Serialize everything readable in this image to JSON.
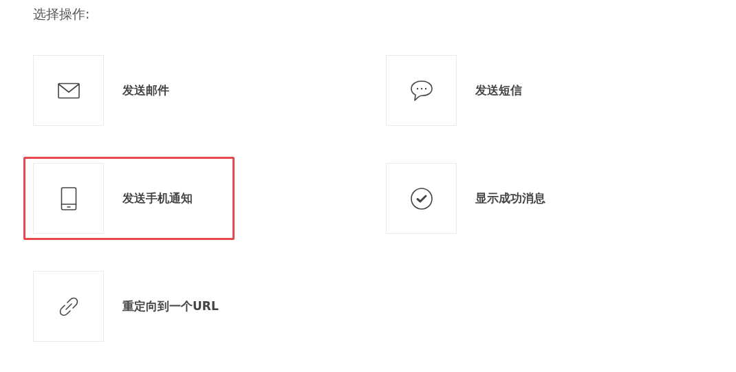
{
  "heading": "选择操作:",
  "actions": [
    {
      "kind": "mail",
      "label": "发送邮件",
      "selected": false
    },
    {
      "kind": "chat",
      "label": "发送短信",
      "selected": false
    },
    {
      "kind": "phone",
      "label": "发送手机通知",
      "selected": true
    },
    {
      "kind": "check",
      "label": "显示成功消息",
      "selected": false
    },
    {
      "kind": "link",
      "label": "重定向到一个URL",
      "selected": false
    }
  ]
}
